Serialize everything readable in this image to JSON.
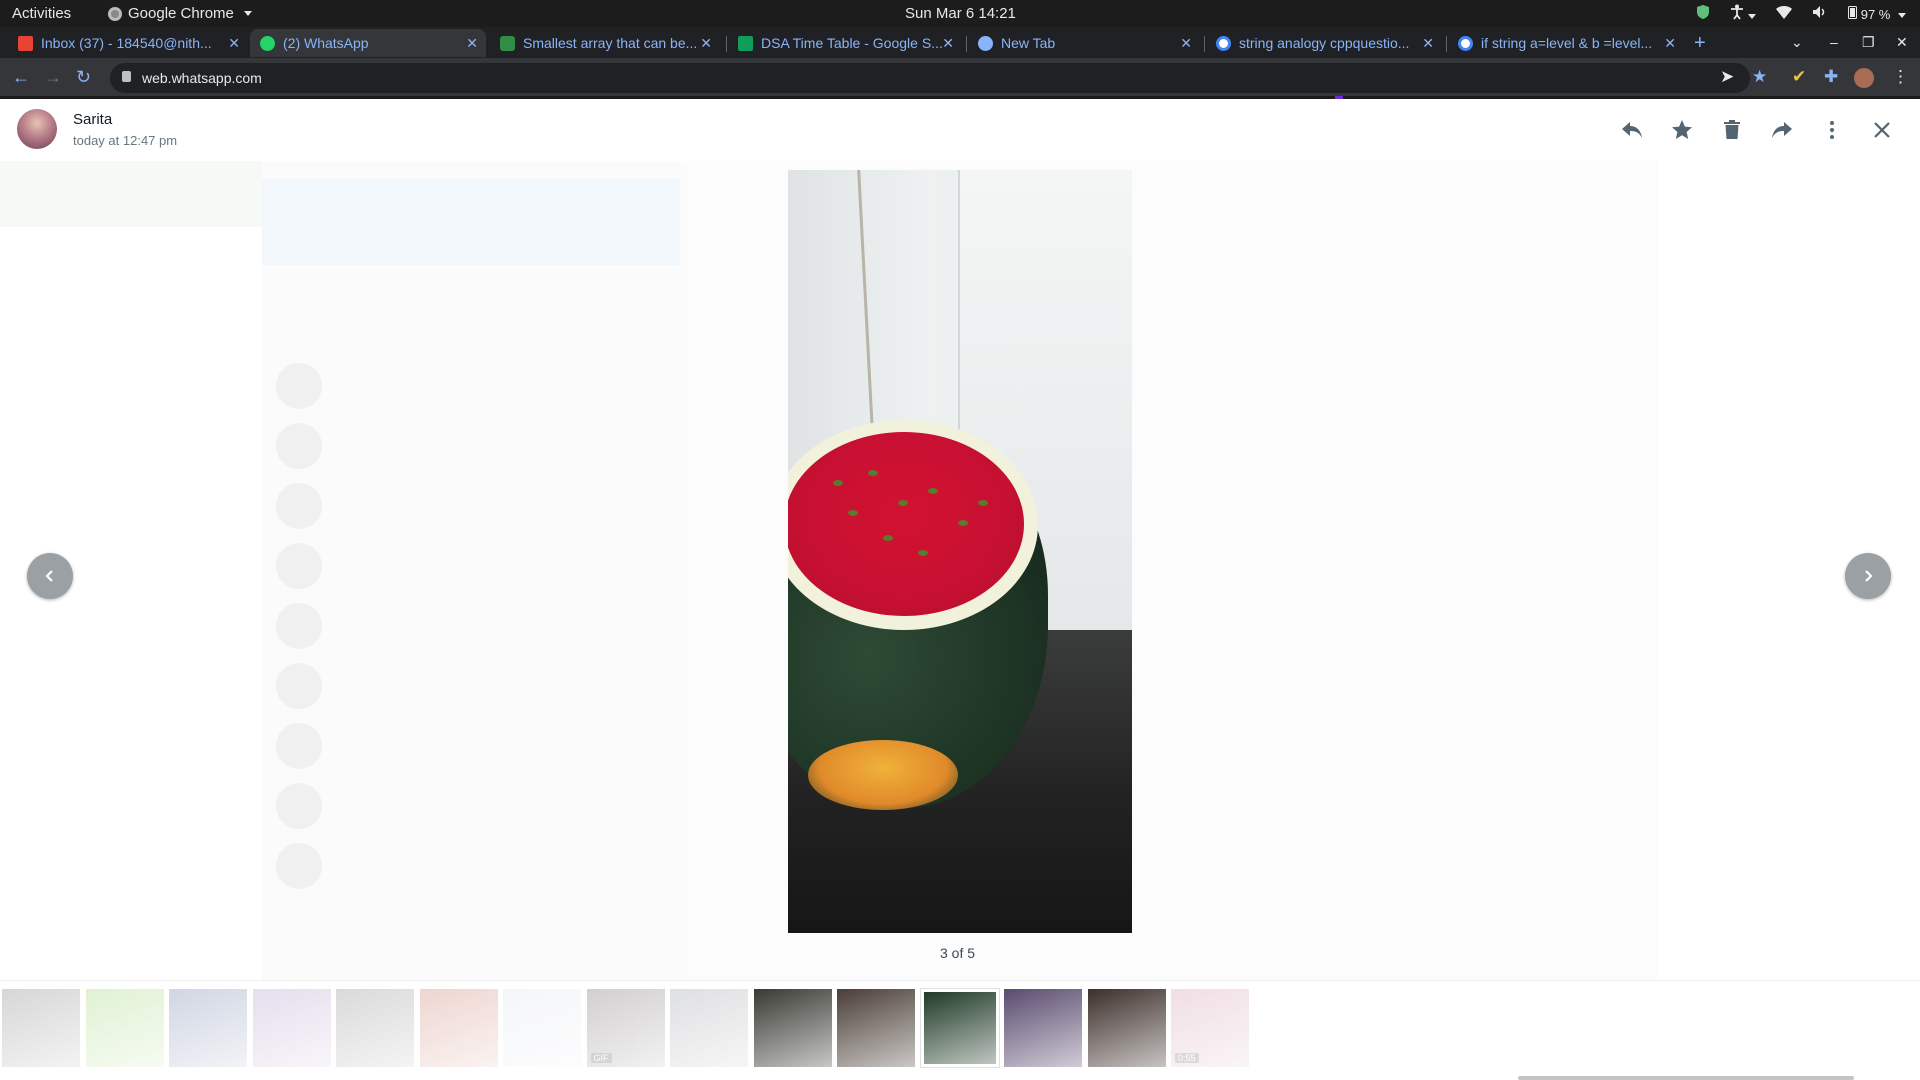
{
  "system_bar": {
    "activities": "Activities",
    "app_name": "Google Chrome",
    "clock": "Sun Mar 6  14:21",
    "battery": "97 %"
  },
  "tabs": [
    {
      "title": "Inbox (37) - 184540@nith...",
      "icon": "gmail-icon",
      "color": "#ea4335"
    },
    {
      "title": "(2) WhatsApp",
      "icon": "whatsapp-icon",
      "color": "#25d366"
    },
    {
      "title": "Smallest array that can be...",
      "icon": "gfg-icon",
      "color": "#2f8d46"
    },
    {
      "title": "DSA Time Table - Google S...",
      "icon": "sheets-icon",
      "color": "#0f9d58"
    },
    {
      "title": "New Tab",
      "icon": "chrome-icon",
      "color": "#8ab4f8"
    },
    {
      "title": "string analogy cppquestio...",
      "icon": "google-icon",
      "color": "#e8eaed"
    },
    {
      "title": "if string a=level & b =level...",
      "icon": "google-icon",
      "color": "#e8eaed"
    }
  ],
  "omnibox": {
    "url": "web.whatsapp.com"
  },
  "viewer": {
    "contact_name": "Sarita",
    "timestamp": "today at 12:47 pm",
    "counter": "3 of 5",
    "actions": [
      "reply-icon",
      "star-icon",
      "delete-icon",
      "forward-icon",
      "more-icon",
      "close-icon"
    ]
  },
  "thumbnails": [
    {
      "kind": "photo",
      "tone": "#6f6e70",
      "faded": true
    },
    {
      "kind": "photo",
      "tone": "#8fcf62",
      "faded": true
    },
    {
      "kind": "photo",
      "tone": "#5b6d9c",
      "faded": true
    },
    {
      "kind": "photo",
      "tone": "#a48ac0",
      "faded": true
    },
    {
      "kind": "photo",
      "tone": "#7d7a78",
      "faded": true
    },
    {
      "kind": "photo",
      "tone": "#c26a58",
      "faded": true
    },
    {
      "kind": "doc",
      "tone": "#dadfe6",
      "faded": true
    },
    {
      "kind": "gif",
      "tone": "#5f5458",
      "faded": true,
      "tag": "GIF"
    },
    {
      "kind": "photo",
      "tone": "#8c8f95",
      "faded": true
    },
    {
      "kind": "photo",
      "tone": "#3a3a34",
      "faded": false
    },
    {
      "kind": "photo",
      "tone": "#4a3e36",
      "faded": false
    },
    {
      "kind": "photo",
      "tone": "#1f3a27",
      "faded": false,
      "selected": true
    },
    {
      "kind": "photo",
      "tone": "#5a4b6f",
      "faded": false
    },
    {
      "kind": "photo",
      "tone": "#3c2f2a",
      "faded": false
    },
    {
      "kind": "video",
      "tone": "#c98ba0",
      "faded": true,
      "tag": "0:55"
    }
  ]
}
